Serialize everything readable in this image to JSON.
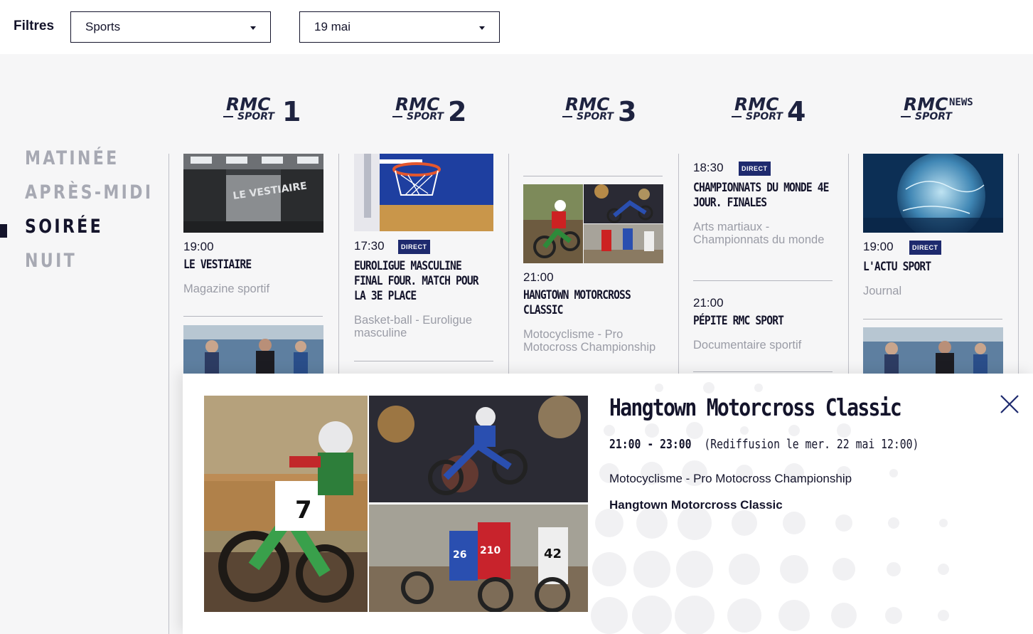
{
  "filters": {
    "label": "Filtres",
    "category": "Sports",
    "date": "19 mai"
  },
  "channels": [
    {
      "brand": "RMC",
      "sub": "SPORT",
      "number": "1"
    },
    {
      "brand": "RMC",
      "sub": "SPORT",
      "number": "2"
    },
    {
      "brand": "RMC",
      "sub": "SPORT",
      "number": "3"
    },
    {
      "brand": "RMC",
      "sub": "SPORT",
      "number": "4"
    },
    {
      "brand": "RMC",
      "sub": "SPORT",
      "number": "NEWS"
    }
  ],
  "periods": [
    "MATINÉE",
    "APRÈS-MIDI",
    "SOIRÉE",
    "NUIT"
  ],
  "active_period": "SOIRÉE",
  "programs": {
    "ch1": {
      "time": "19:00",
      "title": "LE VESTIAIRE",
      "genre": "Magazine sportif",
      "thumb_text": "LE VESTIAIRE"
    },
    "ch2": {
      "time": "17:30",
      "badge": "DIRECT",
      "title": "EUROLIGUE MASCULINE FINAL FOUR. MATCH POUR LA 3E PLACE",
      "genre": "Basket-ball - Euroligue masculine"
    },
    "ch3": {
      "time": "21:00",
      "title": "HANGTOWN MOTORCROSS CLASSIC",
      "genre": "Motocyclisme - Pro Motocross Championship"
    },
    "ch4a": {
      "time": "18:30",
      "badge": "DIRECT",
      "title": "CHAMPIONNATS DU MONDE 4E JOUR. FINALES",
      "genre": "Arts martiaux - Championnats du monde"
    },
    "ch4b": {
      "time": "21:00",
      "title": "PÉPITE RMC SPORT",
      "genre": "Documentaire sportif"
    },
    "ch5": {
      "time": "19:00",
      "badge": "DIRECT",
      "title": "L'ACTU SPORT",
      "genre": "Journal"
    }
  },
  "popup": {
    "title": "Hangtown Motorcross Classic",
    "time_range": "21:00 - 23:00",
    "rebroadcast": "(Rediffusion le mer. 22 mai 12:00)",
    "genre": "Motocyclisme - Pro Motocross Championship",
    "subtitle": "Hangtown Motorcross Classic",
    "rider_numbers": [
      "7",
      "26",
      "210",
      "42"
    ]
  },
  "colors": {
    "navy": "#14142b",
    "badge": "#1e2a6e",
    "muted": "#9a9ca6",
    "period_inactive": "#a7a9b3",
    "background": "#f6f6f7"
  }
}
